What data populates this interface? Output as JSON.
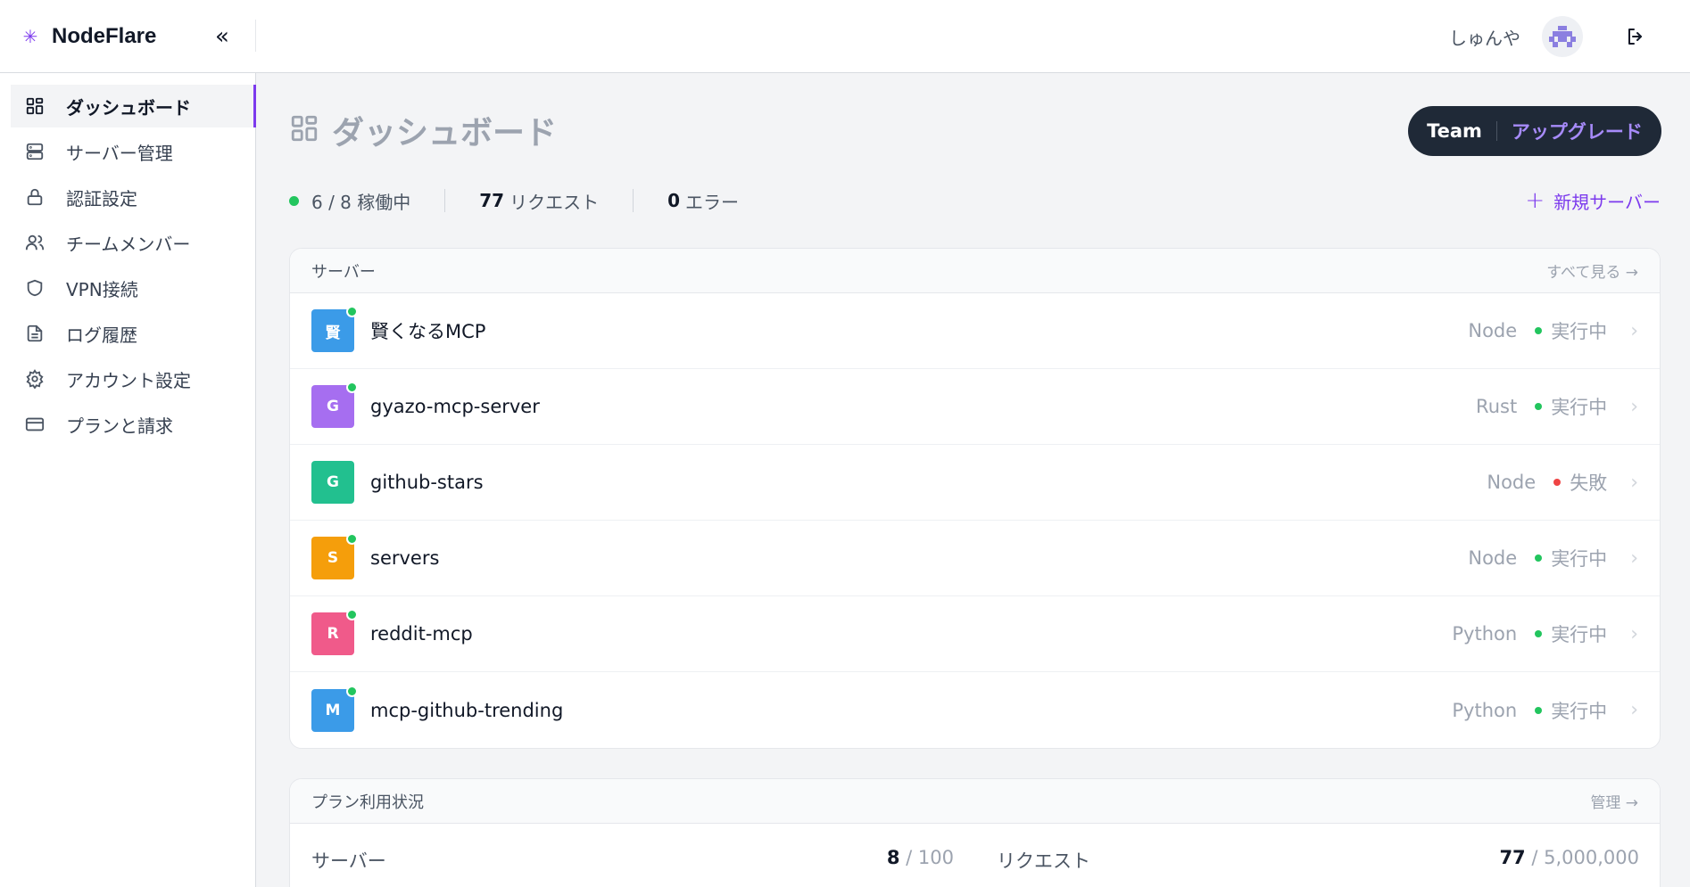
{
  "brand": {
    "name": "NodeFlare",
    "icon": "asterisk-icon"
  },
  "header": {
    "username": "しゅんや"
  },
  "sidebar": {
    "items": [
      {
        "label": "ダッシュボード",
        "icon": "dashboard-grid-icon",
        "active": true
      },
      {
        "label": "サーバー管理",
        "icon": "server-stack-icon"
      },
      {
        "label": "認証設定",
        "icon": "lock-icon"
      },
      {
        "label": "チームメンバー",
        "icon": "users-icon"
      },
      {
        "label": "VPN接続",
        "icon": "shield-icon"
      },
      {
        "label": "ログ履歴",
        "icon": "file-text-icon"
      },
      {
        "label": "アカウント設定",
        "icon": "gear-icon"
      },
      {
        "label": "プランと請求",
        "icon": "credit-card-icon"
      }
    ]
  },
  "main": {
    "title": "ダッシュボード",
    "plan": {
      "name": "Team",
      "upgrade": "アップグレード"
    },
    "stats": {
      "running": "6 / 8 稼働中",
      "requests_value": "77",
      "requests_label": "リクエスト",
      "errors_value": "0",
      "errors_label": "エラー"
    },
    "new_server": "新規サーバー",
    "servers_card": {
      "title": "サーバー",
      "link": "すべて見る →",
      "rows": [
        {
          "initial": "賢",
          "name": "賢くなるMCP",
          "lang": "Node",
          "status": "実行中",
          "color": "#3b9be8",
          "dot": "#22c55e",
          "online": true
        },
        {
          "initial": "G",
          "name": "gyazo-mcp-server",
          "lang": "Rust",
          "status": "実行中",
          "color": "#a66ef0",
          "dot": "#22c55e",
          "online": true
        },
        {
          "initial": "G",
          "name": "github-stars",
          "lang": "Node",
          "status": "失敗",
          "color": "#22c08f",
          "dot": "#ef4444",
          "online": false
        },
        {
          "initial": "S",
          "name": "servers",
          "lang": "Node",
          "status": "実行中",
          "color": "#f59e0b",
          "dot": "#22c55e",
          "online": true
        },
        {
          "initial": "R",
          "name": "reddit-mcp",
          "lang": "Python",
          "status": "実行中",
          "color": "#f05a8a",
          "dot": "#22c55e",
          "online": true
        },
        {
          "initial": "M",
          "name": "mcp-github-trending",
          "lang": "Python",
          "status": "実行中",
          "color": "#3b9be8",
          "dot": "#22c55e",
          "online": true
        }
      ]
    },
    "usage_card": {
      "title": "プラン利用状況",
      "link": "管理 →",
      "servers": {
        "label": "サーバー",
        "used": "8",
        "limit": "/ 100",
        "fraction": 0.08
      },
      "requests": {
        "label": "リクエスト",
        "used": "77",
        "limit": "/ 5,000,000",
        "fraction": 1.54e-05
      }
    }
  }
}
